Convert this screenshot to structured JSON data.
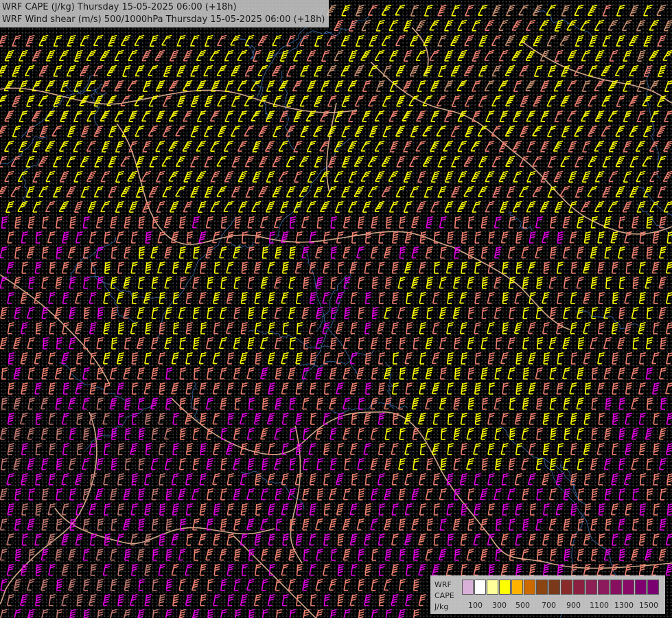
{
  "titles": {
    "line1": "WRF CAPE (J/kg) Thursday 15-05-2025 06:00 (+18h)",
    "line2": "WRF Wind shear (m/s) 500/1000hPa Thursday 15-05-2025 06:00 (+18h)"
  },
  "legend": {
    "model": "WRF",
    "field": "CAPE",
    "unit": "J/kg",
    "ticks": [
      "100",
      "300",
      "500",
      "700",
      "900",
      "1100",
      "1300",
      "1500"
    ],
    "colors": [
      "#d8b0d8",
      "#ffffff",
      "#ffff99",
      "#ffff00",
      "#ffb300",
      "#cc6a00",
      "#8b4513",
      "#7a3a1a",
      "#8a2b2b",
      "#8c2040",
      "#8e1f55",
      "#8c1a5c",
      "#880f60",
      "#8a0a68",
      "#7f006e",
      "#7a0072"
    ]
  },
  "barbs": {
    "colors": {
      "yellow": "#ffff00",
      "salmon": "#f08070",
      "tan": "#c89070",
      "magenta": "#e000e0",
      "brown": "#c07870"
    }
  },
  "map": {
    "border_color": "#e8b898",
    "river_color": "#3a6fb0"
  }
}
